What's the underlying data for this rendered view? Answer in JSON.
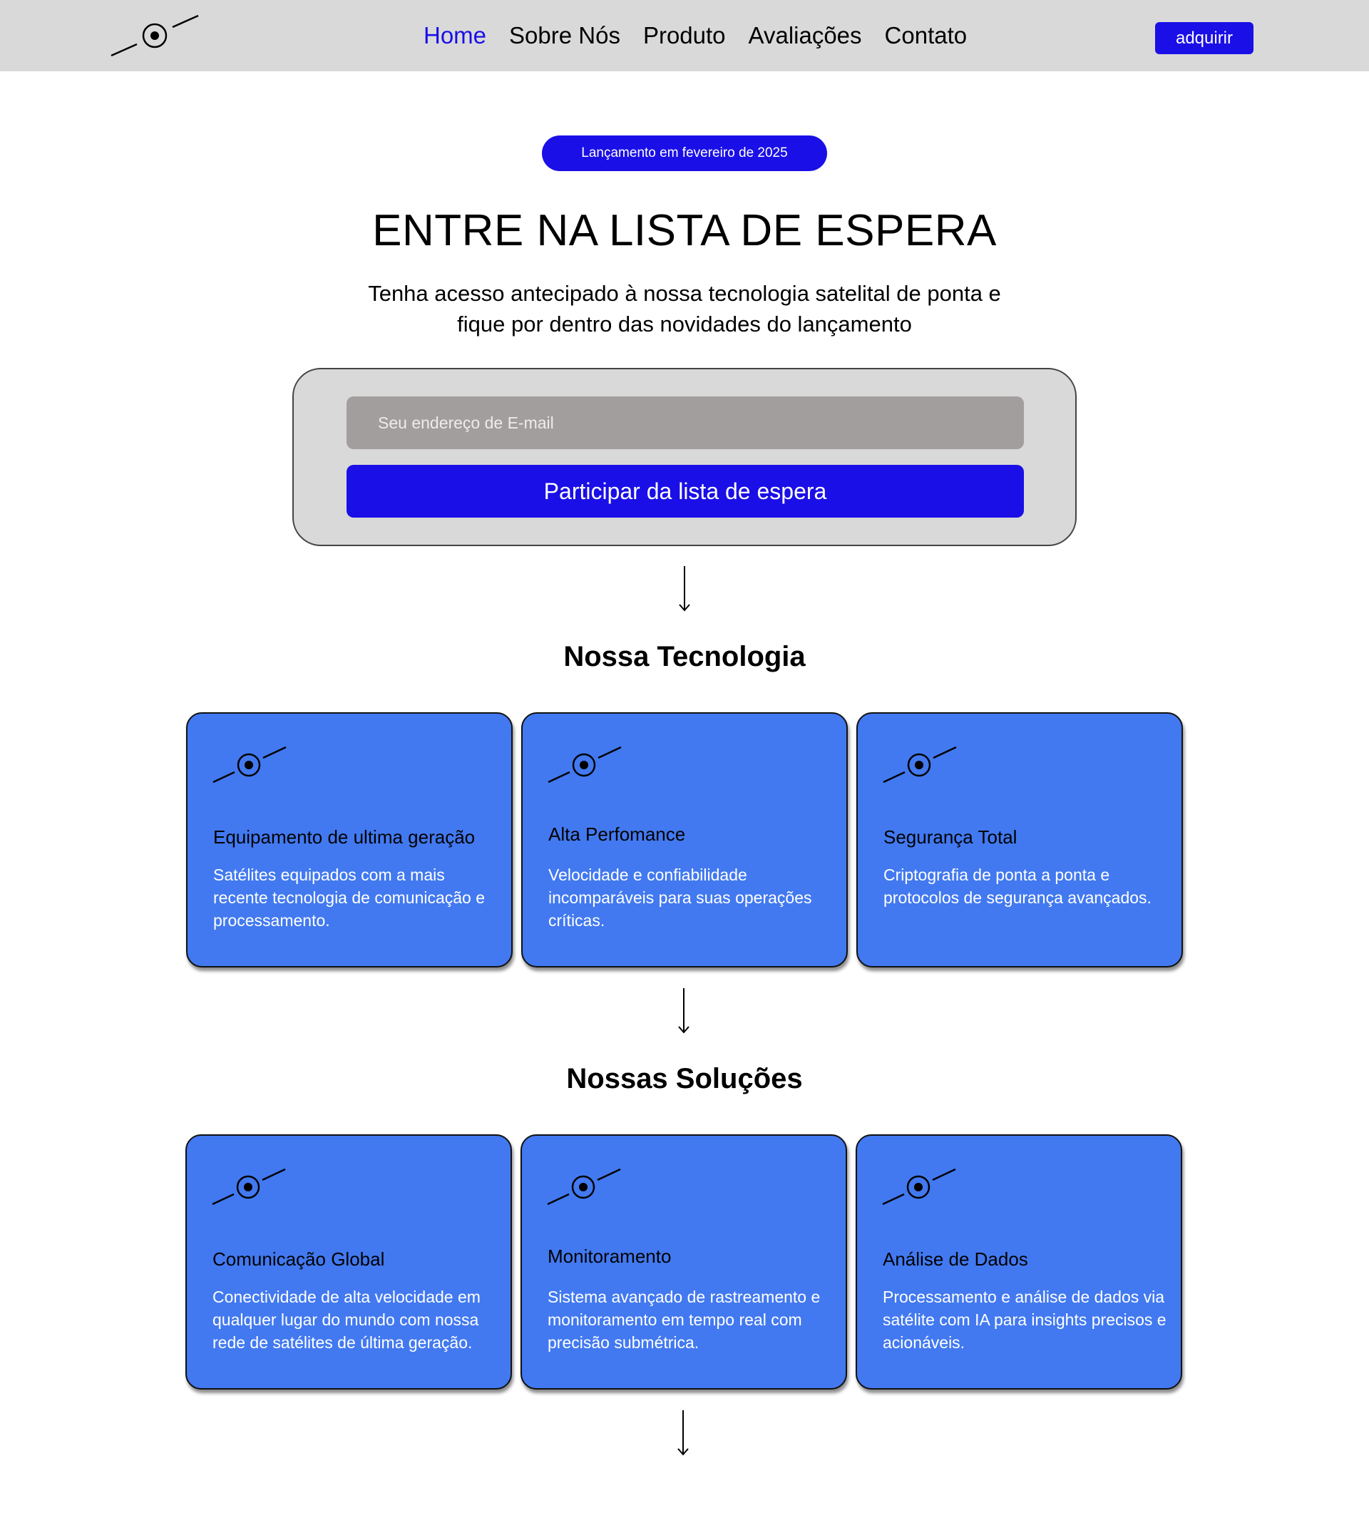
{
  "header": {
    "nav": [
      "Home",
      "Sobre Nós",
      "Produto",
      "Avaliações",
      "Contato"
    ],
    "buy_label": "adquirir"
  },
  "hero": {
    "badge": "Lançamento em fevereiro de 2025",
    "title": "ENTRE NA LISTA DE ESPERA",
    "subtitle_line1": "Tenha acesso antecipado à nossa tecnologia satelital de ponta e",
    "subtitle_line2": "fique por dentro das novidades do lançamento"
  },
  "waitlist": {
    "email_placeholder": "Seu endereço de E-mail",
    "submit_label": "Participar da lista de espera"
  },
  "technology": {
    "title": "Nossa Tecnologia",
    "cards": [
      {
        "title": "Equipamento de ultima geração",
        "text": "Satélites equipados com a mais recente tecnologia de comunicação e processamento."
      },
      {
        "title": "Alta Perfomance",
        "text": "Velocidade e confiabilidade incomparáveis para suas operações críticas."
      },
      {
        "title": "Segurança Total",
        "text": "Criptografia de ponta a ponta e protocolos de segurança avançados."
      }
    ]
  },
  "solutions": {
    "title": "Nossas Soluções",
    "cards": [
      {
        "title": "Comunicação Global",
        "text": "Conectividade de alta velocidade em qualquer lugar do mundo com nossa rede de satélites de última geração."
      },
      {
        "title": "Monitoramento",
        "text": "Sistema avançado de rastreamento e monitoramento em tempo real com precisão submétrica."
      },
      {
        "title": "Análise de Dados",
        "text": "Processamento e análise de dados via satélite com IA para insights precisos e acionáveis."
      }
    ]
  },
  "colors": {
    "accent": "#1a0fe6",
    "card": "#4279f0",
    "header_bg": "#d9d9d9",
    "input_bg": "#a39e9e"
  },
  "icons": [
    "satellite-logo-icon",
    "arrow-down-icon",
    "satellite-icon"
  ]
}
